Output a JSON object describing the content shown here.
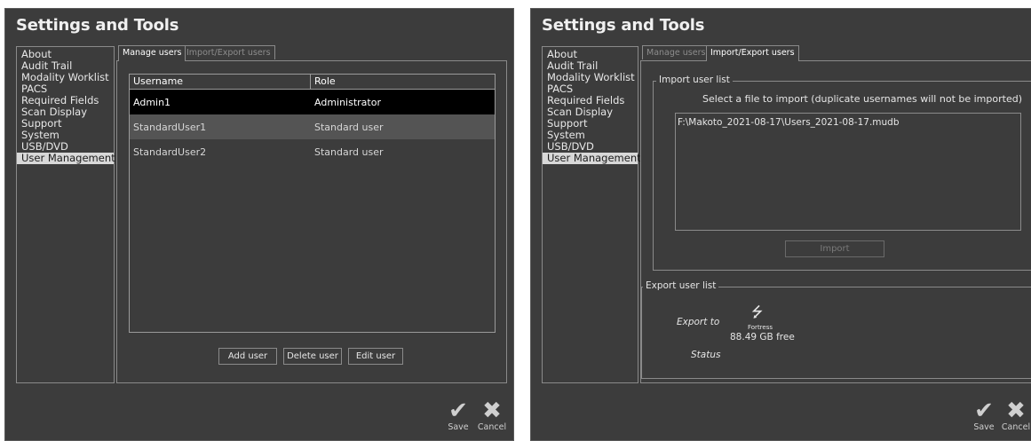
{
  "left": {
    "title": "Settings and Tools",
    "sidebar_items": [
      "About",
      "Audit Trail",
      "Modality Worklist",
      "PACS",
      "Required Fields",
      "Scan Display",
      "Support",
      "System",
      "USB/DVD",
      "User Management"
    ],
    "tabs": [
      "Manage users",
      "Import/Export users"
    ],
    "table": {
      "headers": [
        "Username",
        "Role"
      ],
      "rows": [
        {
          "username": "Admin1",
          "role": "Administrator"
        },
        {
          "username": "StandardUser1",
          "role": "Standard user"
        },
        {
          "username": "StandardUser2",
          "role": "Standard user"
        }
      ]
    },
    "buttons": {
      "add": "Add user",
      "delete": "Delete user",
      "edit": "Edit user"
    },
    "actions": {
      "save": "Save",
      "cancel": "Cancel"
    }
  },
  "right": {
    "title": "Settings and Tools",
    "sidebar_items": [
      "About",
      "Audit Trail",
      "Modality Worklist",
      "PACS",
      "Required Fields",
      "Scan Display",
      "Support",
      "System",
      "USB/DVD",
      "User Management"
    ],
    "tabs": [
      "Manage users",
      "Import/Export users"
    ],
    "import": {
      "legend": "Import user list",
      "instruction": "Select a file to import (duplicate usernames will not be imported)",
      "file_path": "F:\\Makoto_2021-08-17\\Users_2021-08-17.mudb",
      "button": "Import"
    },
    "export": {
      "legend": "Export user list",
      "export_to_label": "Export to",
      "device_icon": "usb-icon",
      "device_name": "Fortress",
      "free_space": "88.49 GB free",
      "status_label": "Status"
    },
    "actions": {
      "save": "Save",
      "cancel": "Cancel"
    }
  },
  "colors": {
    "background": "#3c3c3c",
    "selected_row": "#000000",
    "border": "#8a8a8a"
  }
}
